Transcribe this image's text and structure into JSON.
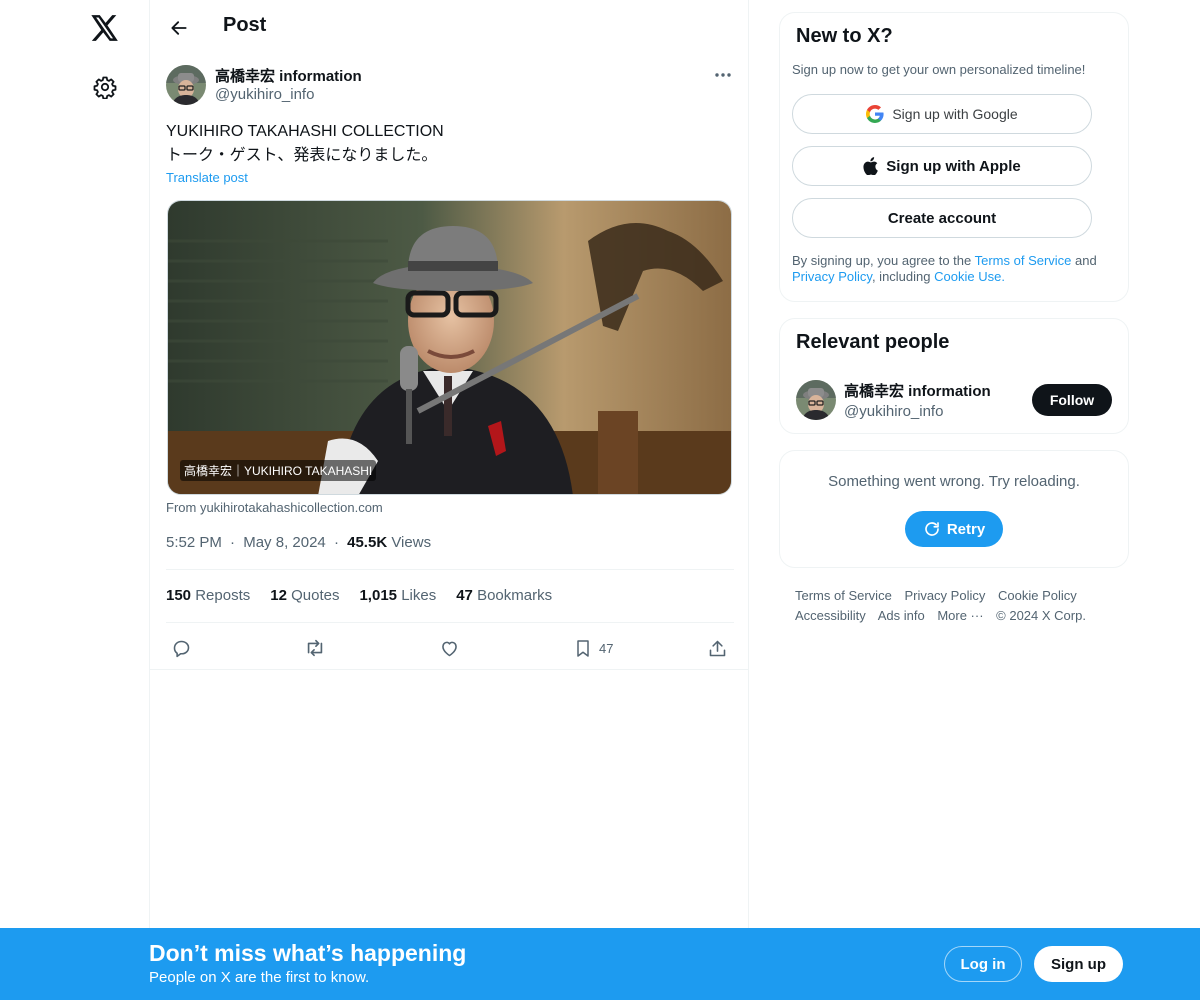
{
  "header": {
    "title": "Post"
  },
  "post": {
    "author_name": "高橋幸宏 information",
    "author_handle": "@yukihiro_info",
    "text_line1": "YUKIHIRO TAKAHASHI COLLECTION",
    "text_line2": "トーク・ゲスト、発表になりました。",
    "translate_label": "Translate post",
    "image_caption": "高橋幸宏｜YUKIHIRO TAKAHASHI",
    "image_source": "From yukihirotakahashicollection.com",
    "time": "5:52 PM",
    "date": "May 8, 2024",
    "views_count": "45.5K",
    "views_label": "Views",
    "separator": "·",
    "stats": {
      "reposts_count": "150",
      "reposts_label": "Reposts",
      "quotes_count": "12",
      "quotes_label": "Quotes",
      "likes_count": "1,015",
      "likes_label": "Likes",
      "bookmarks_count": "47",
      "bookmarks_label": "Bookmarks"
    },
    "actions": {
      "bookmark_count": "47"
    }
  },
  "sidebar": {
    "new_card": {
      "title": "New to X?",
      "subtitle": "Sign up now to get your own personalized timeline!",
      "google_label": "Sign up with Google",
      "apple_label": "Sign up with Apple",
      "create_label": "Create account",
      "terms_prefix": "By signing up, you agree to the ",
      "terms_link": "Terms of Service",
      "and_text": " and ",
      "privacy_link": "Privacy Policy",
      "including_text": ", including ",
      "cookie_link": "Cookie Use",
      "period": "."
    },
    "people_card": {
      "title": "Relevant people",
      "name": "高橋幸宏 information",
      "handle": "@yukihiro_info",
      "follow_label": "Follow"
    },
    "error_card": {
      "message": "Something went wrong. Try reloading.",
      "retry_label": "Retry"
    },
    "footer": {
      "terms": "Terms of Service",
      "privacy": "Privacy Policy",
      "cookie": "Cookie Policy",
      "accessibility": "Accessibility",
      "ads": "Ads info",
      "more": "More ···",
      "copyright": "© 2024 X Corp."
    }
  },
  "banner": {
    "title": "Don’t miss what’s happening",
    "subtitle": "People on X are the first to know.",
    "login_label": "Log in",
    "signup_label": "Sign up"
  },
  "colors": {
    "accent": "#1d9bf0",
    "text_primary": "#0f1419",
    "text_secondary": "#536471",
    "border": "#eff3f4"
  },
  "icons": [
    "x-logo-icon",
    "gear-icon",
    "back-arrow-icon",
    "more-dots-icon",
    "reply-icon",
    "repost-icon",
    "like-heart-icon",
    "bookmark-icon",
    "share-icon",
    "google-icon",
    "apple-icon",
    "refresh-icon"
  ]
}
